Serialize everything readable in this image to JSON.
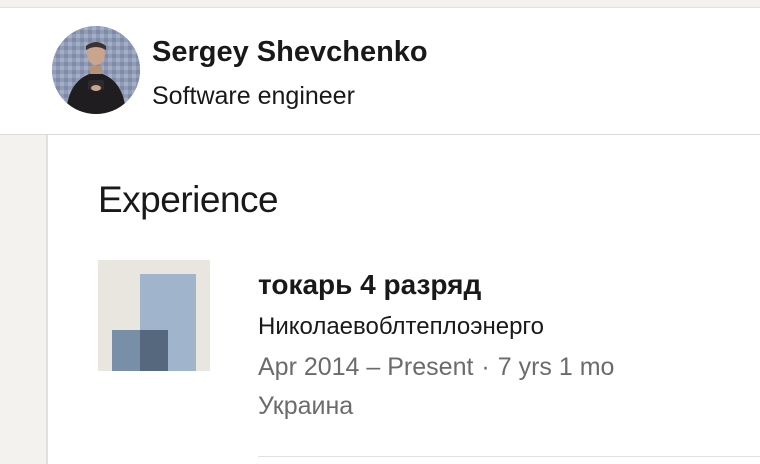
{
  "profile": {
    "name": "Sergey Shevchenko",
    "headline": "Software engineer"
  },
  "experience": {
    "section_title": "Experience",
    "entries": [
      {
        "title": "токарь 4 разряд",
        "company": "Николаевоблтеплоэнерго",
        "date_range": "Apr 2014 – Present",
        "separator": "·",
        "duration": "7 yrs 1 mo",
        "location": "Украина",
        "logo_icon": "company-placeholder-logo-icon"
      }
    ]
  },
  "colors": {
    "logo_bg": "#e9e5df",
    "logo_tall": "#a0b4cb",
    "logo_short": "#788fa8",
    "logo_overlap": "#56687e",
    "meta_text": "#6b6b6b"
  }
}
